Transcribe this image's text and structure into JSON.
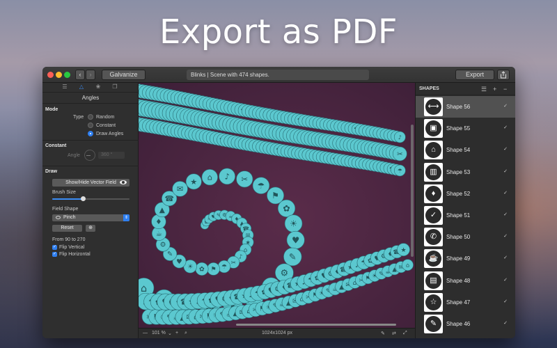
{
  "headline": "Export as PDF",
  "titlebar": {
    "back_label": "‹",
    "forward_label": "›",
    "doc_button": "Galvanize",
    "status": "Blinks | Scene with 474 shapes.",
    "export_label": "Export",
    "share_icon": "share-icon"
  },
  "left_panel": {
    "panel_title": "Angles",
    "mode_section": "Mode",
    "type_label": "Type",
    "type_options": [
      "Random",
      "Constant",
      "Draw Angles"
    ],
    "type_selected": "Draw Angles",
    "constant_section": "Constant",
    "angle_label": "Angle",
    "angle_value": "360 °",
    "draw_section": "Draw",
    "vector_field_button": "Show/Hide Vector Field",
    "brush_size_label": "Brush Size",
    "brush_size_level": 0.4,
    "field_shape_label": "Field Shape",
    "field_shape_value": "Pinch",
    "reset_label": "Reset",
    "range_text": "From 90 to 270",
    "flip_vertical_label": "Flip Vertical",
    "flip_vertical_checked": true,
    "flip_horizontal_label": "Flip Horizontal",
    "flip_horizontal_checked": true
  },
  "canvas": {
    "background_color": "#4a2540",
    "shape_color": "#5bc8cf",
    "zoom_minus": "—",
    "zoom_value": "101 %",
    "zoom_plus": "+",
    "size_text": "1024x1024 px"
  },
  "shapes_panel": {
    "title": "SHAPES",
    "items": [
      {
        "name": "Shape 56",
        "glyph": "⟷",
        "icon": "dumbbell-icon",
        "checked": "✓",
        "selected": true
      },
      {
        "name": "Shape 55",
        "glyph": "▣",
        "icon": "floppy-disk-icon",
        "checked": "✓",
        "selected": false
      },
      {
        "name": "Shape 54",
        "glyph": "⌂",
        "icon": "upload-house-icon",
        "checked": "✓",
        "selected": false
      },
      {
        "name": "Shape 53",
        "glyph": "▥",
        "icon": "trash-icon",
        "checked": "✓",
        "selected": false
      },
      {
        "name": "Shape 52",
        "glyph": "♦",
        "icon": "tie-icon",
        "checked": "✓",
        "selected": false
      },
      {
        "name": "Shape 51",
        "glyph": "✓",
        "icon": "badge-check-icon",
        "checked": "✓",
        "selected": false
      },
      {
        "name": "Shape 50",
        "glyph": "✆",
        "icon": "phone-icon",
        "checked": "✓",
        "selected": false
      },
      {
        "name": "Shape 49",
        "glyph": "☕",
        "icon": "teapot-icon",
        "checked": "✓",
        "selected": false
      },
      {
        "name": "Shape 48",
        "glyph": "▤",
        "icon": "document-icon",
        "checked": "✓",
        "selected": false
      },
      {
        "name": "Shape 47",
        "glyph": "☆",
        "icon": "star-icon",
        "checked": "✓",
        "selected": false
      },
      {
        "name": "Shape 46",
        "glyph": "✎",
        "icon": "pencil-tag-icon",
        "checked": "✓",
        "selected": false
      }
    ]
  }
}
